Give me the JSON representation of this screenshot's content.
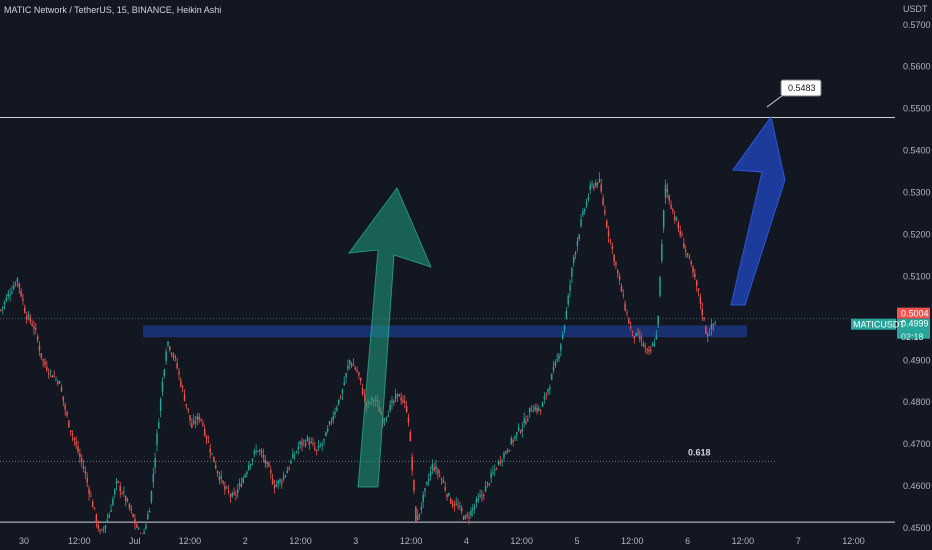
{
  "header": {
    "title": "MATIC Network / TetherUS, 15, BINANCE, Heikin Ashi",
    "currency": "USDT"
  },
  "chart_data": {
    "type": "candlestick",
    "title": "MATIC Network / TetherUS, 15, BINANCE, Heikin Ashi",
    "ylim": [
      0.45,
      0.574
    ],
    "y_ticks": [
      "0.5700",
      "0.5600",
      "0.5500",
      "0.5400",
      "0.5300",
      "0.5200",
      "0.5100",
      "0.4900",
      "0.4800",
      "0.4700",
      "0.4600",
      "0.4500"
    ],
    "x_ticks": [
      "30",
      "12:00",
      "Jul",
      "12:00",
      "2",
      "12:00",
      "3",
      "12:00",
      "4",
      "12:00",
      "5",
      "12:00",
      "6",
      "12:00",
      "7",
      "12:00"
    ],
    "colors": {
      "up": "#26a69a",
      "down": "#ef5350",
      "background": "#131722",
      "green_arrow": "#1f9c80",
      "blue_arrow": "#1e3fa8",
      "zone": "#1c3a8c"
    },
    "price_path": [
      0.502,
      0.506,
      0.5095,
      0.501,
      0.498,
      0.49,
      0.487,
      0.485,
      0.476,
      0.47,
      0.464,
      0.456,
      0.448,
      0.453,
      0.461,
      0.457,
      0.452,
      0.447,
      0.456,
      0.476,
      0.495,
      0.49,
      0.482,
      0.474,
      0.477,
      0.47,
      0.464,
      0.459,
      0.457,
      0.461,
      0.466,
      0.469,
      0.465,
      0.46,
      0.462,
      0.466,
      0.47,
      0.471,
      0.468,
      0.471,
      0.477,
      0.482,
      0.49,
      0.487,
      0.479,
      0.481,
      0.476,
      0.479,
      0.482,
      0.478,
      0.451,
      0.458,
      0.465,
      0.462,
      0.457,
      0.455,
      0.452,
      0.455,
      0.458,
      0.462,
      0.466,
      0.469,
      0.472,
      0.475,
      0.479,
      0.478,
      0.484,
      0.49,
      0.5,
      0.515,
      0.524,
      0.531,
      0.533,
      0.522,
      0.513,
      0.504,
      0.496,
      0.495,
      0.491,
      0.496,
      0.532,
      0.525,
      0.519,
      0.513,
      0.506,
      0.496,
      0.499
    ],
    "horizontal_levels": [
      {
        "value": 0.5479,
        "label": "0.5479",
        "style": "solid",
        "color": "#d1d4dc"
      },
      {
        "value": 0.4514,
        "label": "0.4514",
        "style": "solid",
        "color": "#d1d4dc"
      },
      {
        "value": 0.4659,
        "label": "0.618",
        "style": "dotted",
        "color": "#787b86"
      },
      {
        "value": 0.4999,
        "label": "",
        "style": "dotted",
        "color": "#4a7a78"
      }
    ],
    "support_zone": {
      "low": 0.4955,
      "high": 0.4983
    },
    "annotations": {
      "callout": "0.5483",
      "fib_label": "0.618"
    },
    "price_tags": [
      {
        "text": "0.5004",
        "bg": "#ef5350",
        "fg": "#ffffff",
        "value": 0.5004
      },
      {
        "text": "0.4999",
        "bg": "#26a69a",
        "fg": "#ffffff",
        "value": 0.4999
      },
      {
        "text": "02:18",
        "bg": "#26a69a",
        "fg": "#ffffff",
        "value": 0.4977
      },
      {
        "text": "MATICUSDT",
        "bg": "#26a69a",
        "fg": "#ffffff",
        "value": 0.4999
      }
    ],
    "grid": false
  }
}
